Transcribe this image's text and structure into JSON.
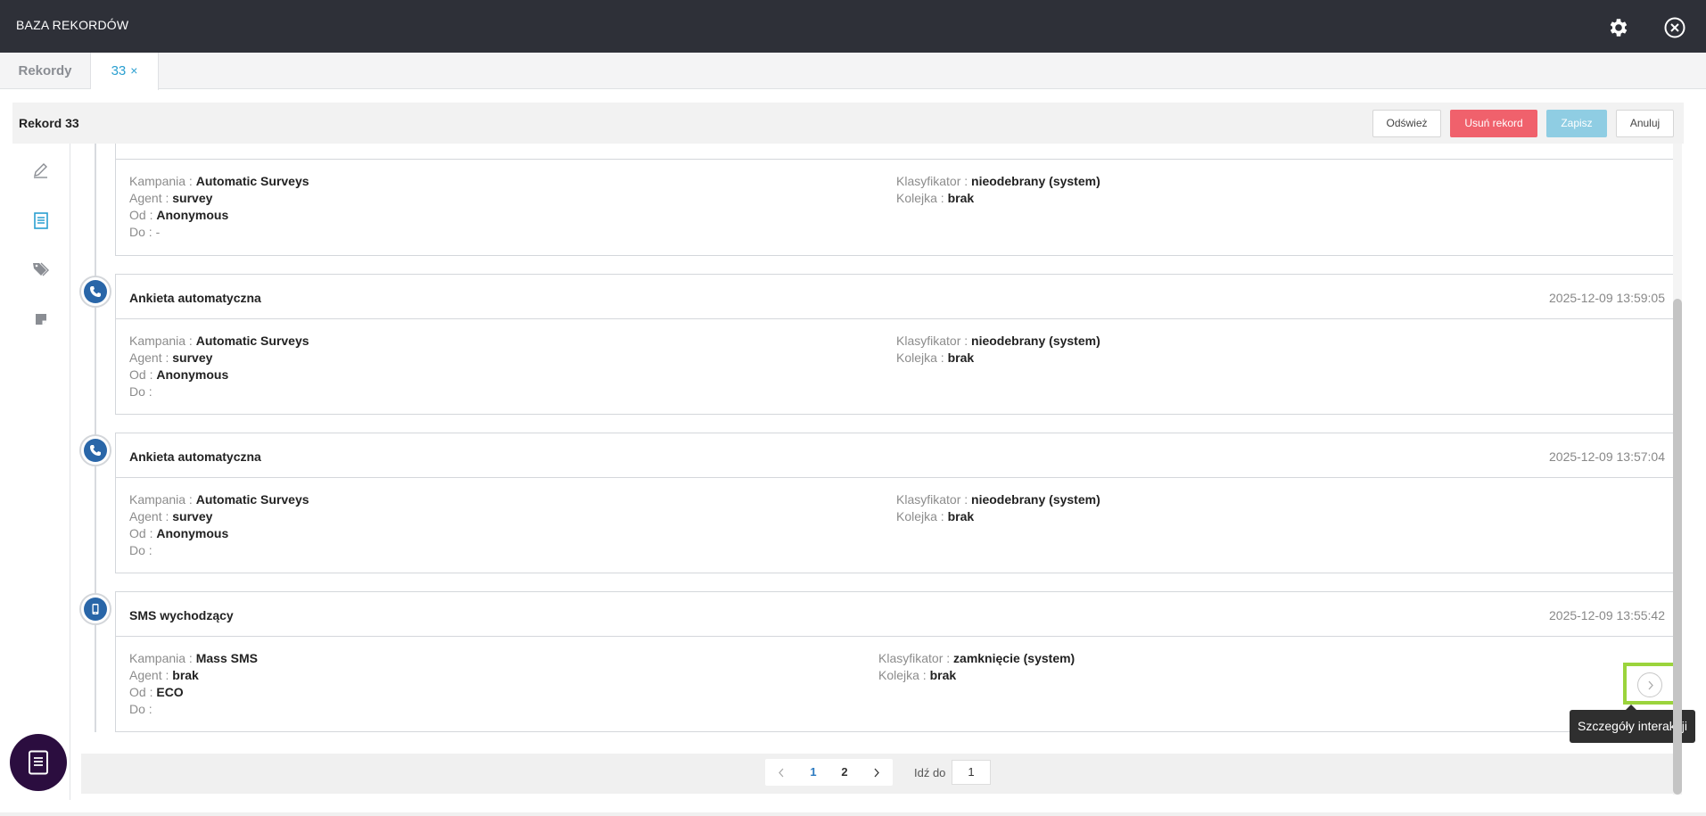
{
  "app": {
    "title": "BAZA REKORDÓW"
  },
  "tabs": {
    "records": "Rekordy",
    "active": "33",
    "close": "×"
  },
  "record": {
    "title": "Rekord 33"
  },
  "actions": {
    "refresh": "Odśwież",
    "delete": "Usuń rekord",
    "save": "Zapisz",
    "cancel": "Anuluj"
  },
  "labels": {
    "campaign": "Kampania :",
    "agent": "Agent :",
    "from": "Od :",
    "to": "Do :",
    "classifier": "Klasyfikator :",
    "queue": "Kolejka :"
  },
  "interactions": [
    {
      "title": "",
      "time": "",
      "campaign": "Automatic Surveys",
      "agent": "survey",
      "from": "Anonymous",
      "to": "-",
      "classifier": "nieodebrany (system)",
      "queue": "brak",
      "icon": "phone-icon"
    },
    {
      "title": "Ankieta automatyczna",
      "time": "2025-12-09 13:59:05",
      "campaign": "Automatic Surveys",
      "agent": "survey",
      "from": "Anonymous",
      "to": "",
      "classifier": "nieodebrany (system)",
      "queue": "brak",
      "icon": "phone-icon"
    },
    {
      "title": "Ankieta automatyczna",
      "time": "2025-12-09 13:57:04",
      "campaign": "Automatic Surveys",
      "agent": "survey",
      "from": "Anonymous",
      "to": "",
      "classifier": "nieodebrany (system)",
      "queue": "brak",
      "icon": "phone-icon"
    },
    {
      "title": "SMS wychodzący",
      "time": "2025-12-09 13:55:42",
      "campaign": "Mass SMS",
      "agent": "brak",
      "from": "ECO",
      "to": "",
      "classifier": "zamknięcie (system)",
      "queue": "brak",
      "icon": "mobile-icon"
    }
  ],
  "tooltip": "Szczegóły interakcji",
  "pagination": {
    "pages": [
      "1",
      "2"
    ],
    "current": "1",
    "goto_label": "Idź do",
    "goto_value": "1"
  },
  "colors": {
    "topbar": "#2e3038",
    "accent": "#2a9fd0",
    "danger": "#f0616c",
    "badge": "#2966a8",
    "highlight": "#9bd43c"
  }
}
